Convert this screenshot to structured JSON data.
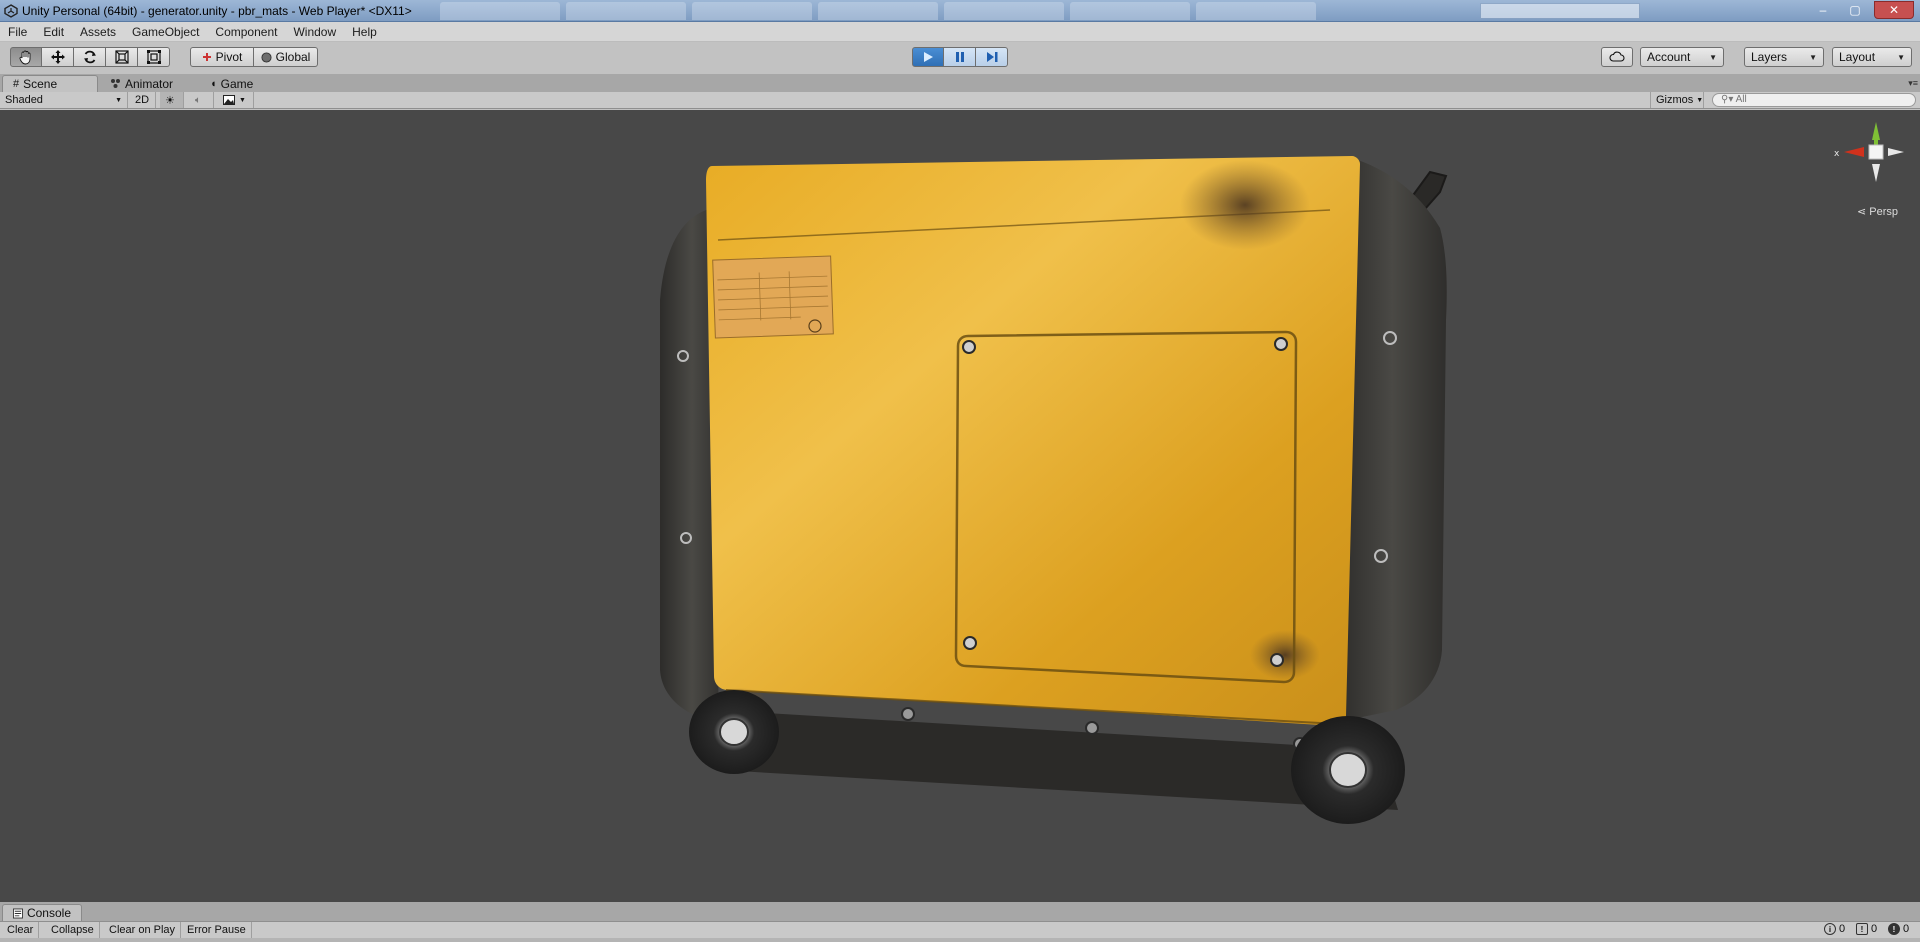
{
  "window": {
    "title": "Unity Personal (64bit) - generator.unity - pbr_mats - Web Player* <DX11>",
    "minimize": "–",
    "restore": "▢",
    "close": "✕"
  },
  "menu": [
    "File",
    "Edit",
    "Assets",
    "GameObject",
    "Component",
    "Window",
    "Help"
  ],
  "toolbar": {
    "pivot": "Pivot",
    "global": "Global",
    "account": "Account",
    "layers": "Layers",
    "layout": "Layout"
  },
  "tabs": {
    "scene": "Scene",
    "animator": "Animator",
    "game": "Game"
  },
  "scene_toolbar": {
    "shading": "Shaded",
    "mode_2d": "2D",
    "gizmos": "Gizmos",
    "search_placeholder": "All"
  },
  "viewport": {
    "projection": "Persp",
    "axis_x": "x"
  },
  "console": {
    "tab": "Console",
    "clear": "Clear",
    "collapse": "Collapse",
    "clear_on_play": "Clear on Play",
    "error_pause": "Error Pause",
    "info_count": "0",
    "warning_count": "0",
    "error_count": "0"
  },
  "colors": {
    "viewport_bg": "#484848",
    "generator_body": "#e0a21e",
    "frame_dark": "#3a3936",
    "play_active": "#2f6fb5"
  }
}
